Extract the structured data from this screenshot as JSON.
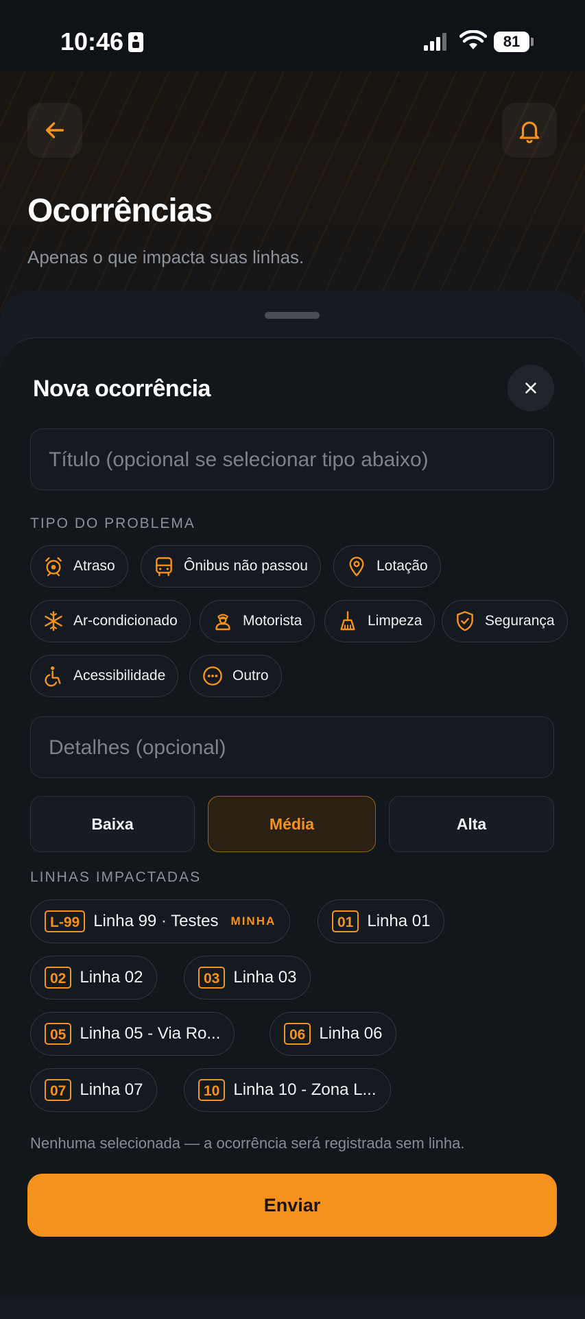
{
  "status_bar": {
    "time": "10:46",
    "battery": "81"
  },
  "header": {
    "title": "Ocorrências",
    "subtitle": "Apenas o que impacta suas linhas."
  },
  "sheet": {
    "title": "Nova ocorrência",
    "title_placeholder": "Título (opcional se selecionar tipo abaixo)",
    "problem_type_label": "TIPO DO PROBLEMA",
    "problem_types": [
      {
        "label": "Atraso",
        "icon": "alarm-clock-icon"
      },
      {
        "label": "Ônibus não passou",
        "icon": "bus-icon"
      },
      {
        "label": "Lotação",
        "icon": "location-pin-icon"
      },
      {
        "label": "Ar-condicionado",
        "icon": "snowflake-icon"
      },
      {
        "label": "Motorista",
        "icon": "driver-icon"
      },
      {
        "label": "Limpeza",
        "icon": "broom-icon"
      },
      {
        "label": "Segurança",
        "icon": "shield-icon"
      },
      {
        "label": "Acessibilidade",
        "icon": "wheelchair-icon"
      },
      {
        "label": "Outro",
        "icon": "more-circle-icon"
      }
    ],
    "details_placeholder": "Detalhes (opcional)",
    "severity": {
      "options": [
        "Baixa",
        "Média",
        "Alta"
      ],
      "selected": "Média"
    },
    "lines_label": "LINHAS IMPACTADAS",
    "lines": [
      {
        "code": "L-99",
        "name": "Linha 99 · Testes",
        "badge": "MINHA"
      },
      {
        "code": "01",
        "name": "Linha 01"
      },
      {
        "code": "02",
        "name": "Linha 02"
      },
      {
        "code": "03",
        "name": "Linha 03"
      },
      {
        "code": "05",
        "name": "Linha 05 - Via Ro..."
      },
      {
        "code": "06",
        "name": "Linha 06"
      },
      {
        "code": "07",
        "name": "Linha 07"
      },
      {
        "code": "10",
        "name": "Linha 10 - Zona L..."
      }
    ],
    "note": "Nenhuma selecionada — a ocorrência será registrada sem linha.",
    "submit_label": "Enviar"
  },
  "colors": {
    "accent": "#f5921e",
    "background": "#12171c"
  }
}
